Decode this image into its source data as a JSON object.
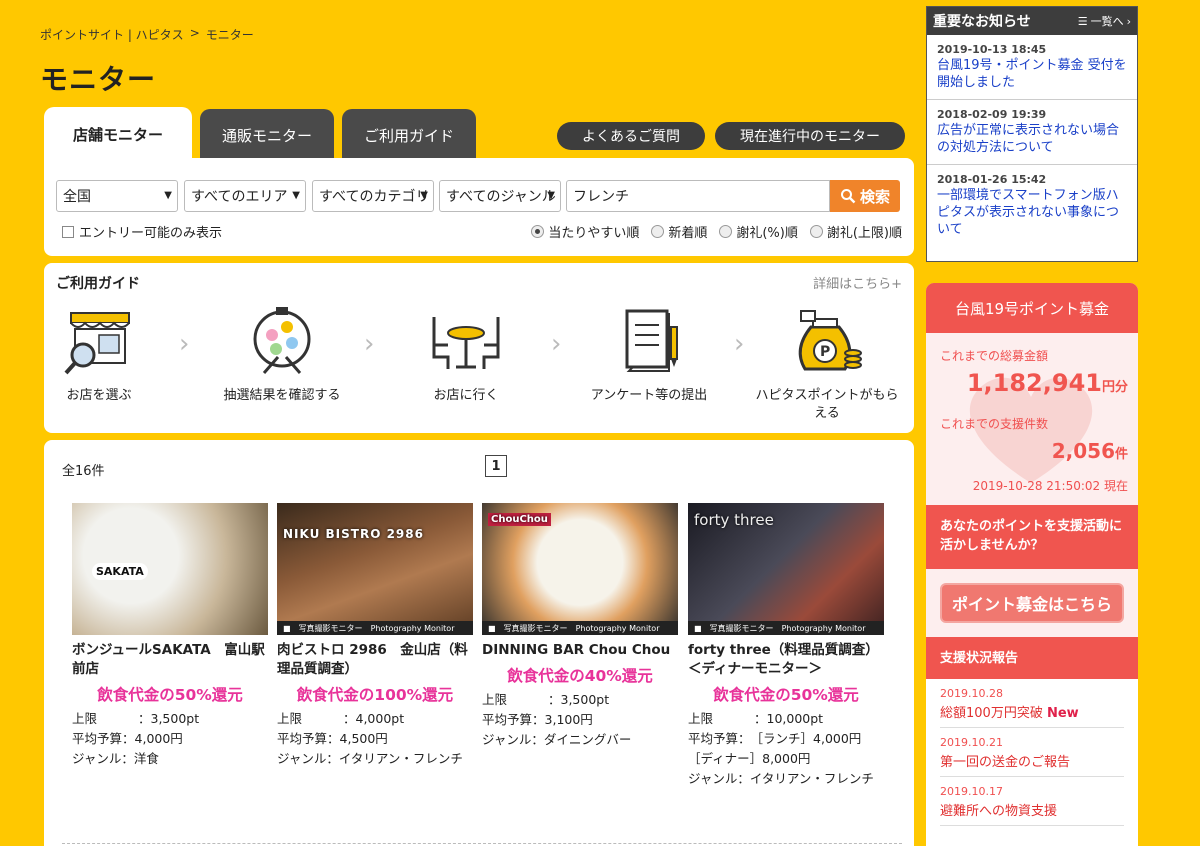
{
  "breadcrumb": {
    "site": "ポイントサイト | ハピタス",
    "sep": ">",
    "current": "モニター"
  },
  "page_title": "モニター",
  "tabs": [
    {
      "label": "店舗モニター",
      "active": true
    },
    {
      "label": "通販モニター",
      "active": false
    },
    {
      "label": "ご利用ガイド",
      "active": false
    }
  ],
  "buttons": {
    "faq": "よくあるご質問",
    "current": "現在進行中のモニター"
  },
  "search": {
    "region": "全国",
    "area": "すべてのエリア",
    "category": "すべてのカテゴリ",
    "genre": "すべてのジャンル",
    "keyword": "フレンチ",
    "search_label": "検索",
    "entry_only": "エントリー可能のみ表示",
    "sorts": [
      {
        "label": "当たりやすい順",
        "selected": true
      },
      {
        "label": "新着順",
        "selected": false
      },
      {
        "label": "謝礼(%)順",
        "selected": false
      },
      {
        "label": "謝礼(上限)順",
        "selected": false
      }
    ]
  },
  "guide": {
    "title": "ご利用ガイド",
    "more": "詳細はこちら+",
    "steps": [
      {
        "label": "お店を選ぶ",
        "icon": "shop-search-icon"
      },
      {
        "label": "抽選結果を確認する",
        "icon": "lottery-icon"
      },
      {
        "label": "お店に行く",
        "icon": "table-icon"
      },
      {
        "label": "アンケート等の提出",
        "icon": "survey-icon"
      },
      {
        "label": "ハピタスポイントがもらえる",
        "icon": "point-bag-icon"
      }
    ]
  },
  "results": {
    "count": "全16件",
    "page": "1",
    "photo_band_jp": "写真撮影モニター",
    "photo_band_en": "Photography Monitor",
    "label_limit": "上限",
    "label_budget": "平均予算：",
    "label_genre": "ジャンル：",
    "cards": [
      {
        "name": "ボンジュールSAKATA　富山駅前店",
        "rate": "飲食代金の50%還元",
        "limit": "：3,500pt",
        "budget": "4,000円",
        "genre": "洋食",
        "photo_text": "SAKATA"
      },
      {
        "name": "肉ビストロ 2986　金山店（料理品質調査）",
        "rate": "飲食代金の100%還元",
        "limit": "：4,000pt",
        "budget": "4,500円",
        "genre": "イタリアン・フレンチ",
        "photo_text": "NIKU BISTRO 2986"
      },
      {
        "name": "DINNING BAR Chou Chou",
        "rate": "飲食代金の40%還元",
        "limit": "：3,500pt",
        "budget": "3,100円",
        "genre": "ダイニングバー",
        "photo_text": "ChouChou"
      },
      {
        "name": "forty three（料理品質調査）＜ディナーモニター＞",
        "rate": "飲食代金の50%還元",
        "limit": "：10,000pt",
        "budget": "［ランチ］4,000円",
        "budget2": "［ディナー］8,000円",
        "genre": "イタリアン・フレンチ",
        "photo_text": "forty three"
      }
    ]
  },
  "notices": {
    "title": "重要なお知らせ",
    "all_label": "一覧へ",
    "items": [
      {
        "date": "2019-10-13 18:45",
        "text": "台風19号・ポイント募金 受付を開始しました"
      },
      {
        "date": "2018-02-09 19:39",
        "text": "広告が正常に表示されない場合の対処方法について"
      },
      {
        "date": "2018-01-26 15:42",
        "text": "一部環境でスマートフォン版ハピタスが表示されない事象について"
      }
    ]
  },
  "donation": {
    "title": "台風19号ポイント募金",
    "total_label": "これまでの総募金額",
    "total": "1,182,941",
    "total_unit": "円分",
    "count_label": "これまでの支援件数",
    "count": "2,056",
    "count_unit": "件",
    "as_of": "2019-10-28 21:50:02 現在",
    "cta": "あなたのポイントを支援活動に活かしませんか？",
    "button": "ポイント募金はこちら",
    "report_title": "支援状況報告",
    "reports": [
      {
        "date": "2019.10.28",
        "text": "総額100万円突破",
        "badge": "New"
      },
      {
        "date": "2019.10.21",
        "text": "第一回の送金のご報告",
        "badge": ""
      },
      {
        "date": "2019.10.17",
        "text": "避難所への物資支援",
        "badge": ""
      }
    ]
  },
  "colors": {
    "background": "#ffc800",
    "accent": "#f0842a",
    "pink": "#e8339a",
    "donation_red": "#f0554f",
    "link_blue": "#1a40c8"
  }
}
